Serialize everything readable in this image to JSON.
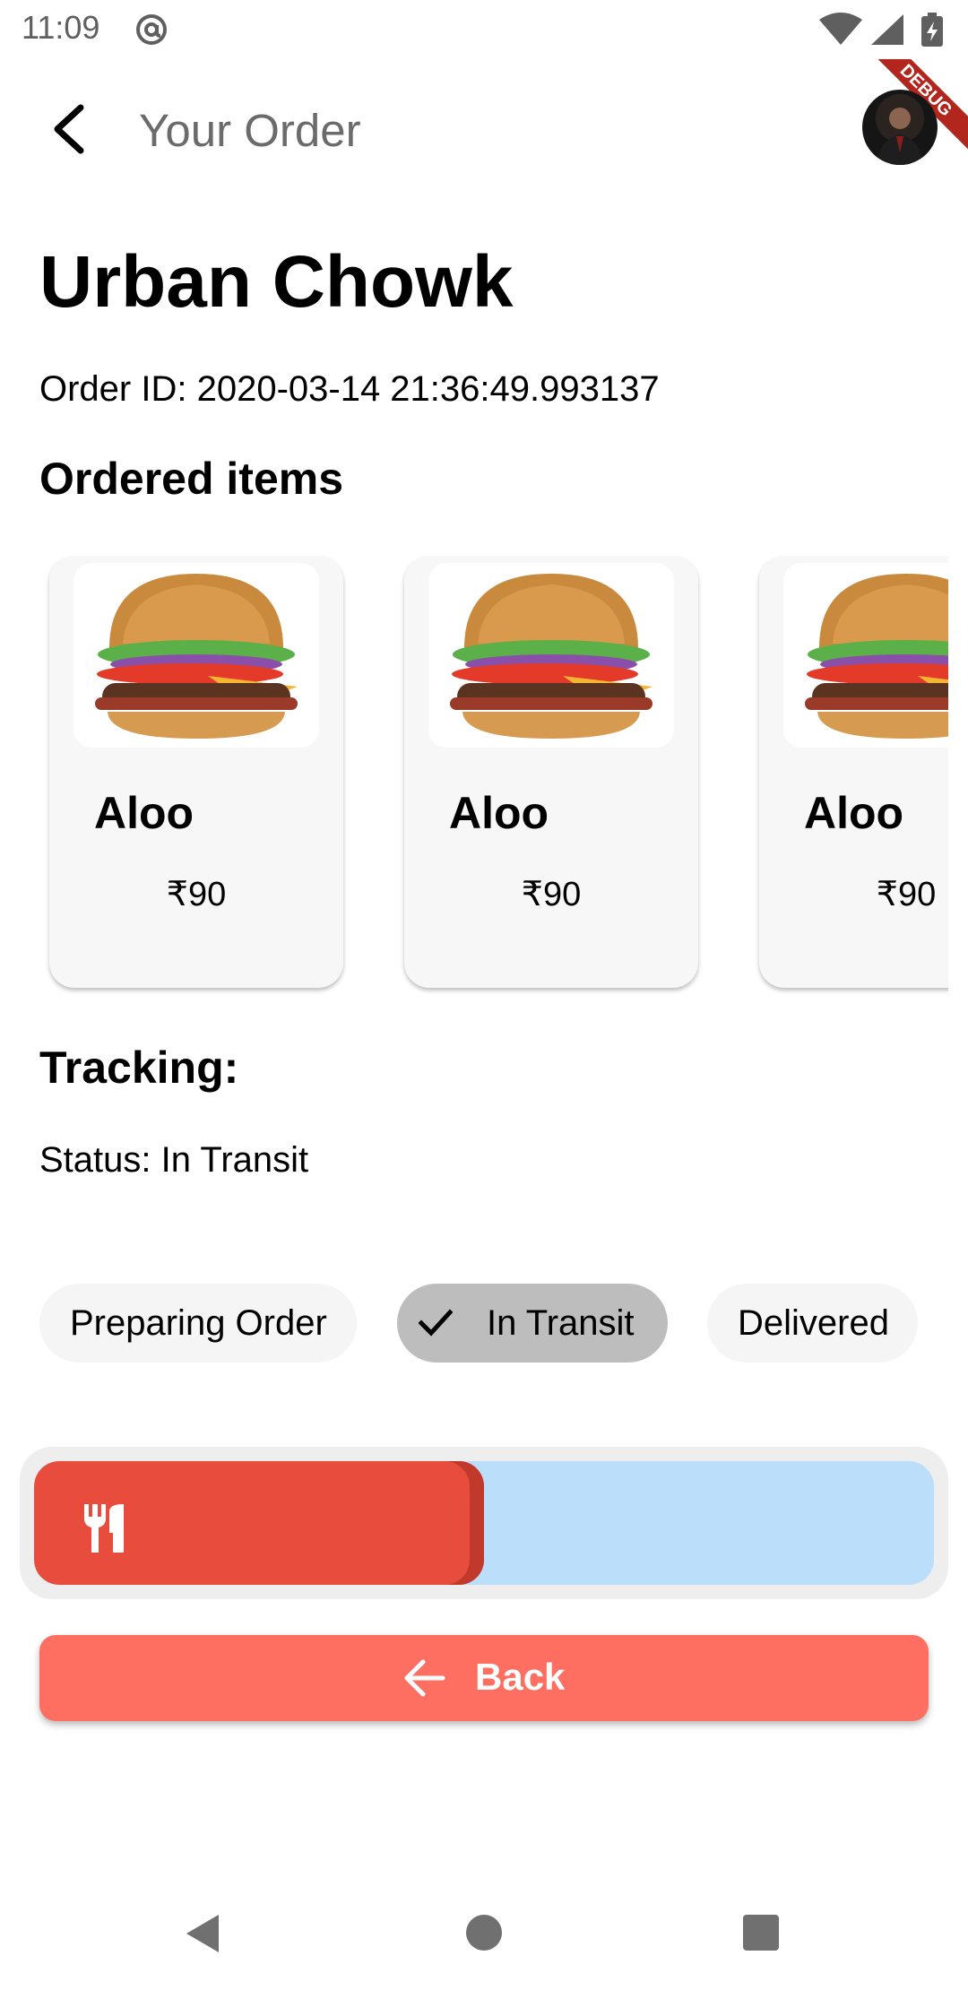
{
  "status_bar": {
    "time": "11:09"
  },
  "debug_banner": {
    "label": "DEBUG"
  },
  "app_bar": {
    "title": "Your Order"
  },
  "restaurant": {
    "name": "Urban Chowk"
  },
  "order": {
    "id_text": "Order ID: 2020-03-14 21:36:49.993137"
  },
  "ordered_items": {
    "heading": "Ordered items",
    "items": [
      {
        "name": "Aloo",
        "price": "₹90"
      },
      {
        "name": "Aloo",
        "price": "₹90"
      },
      {
        "name": "Aloo",
        "price": "₹90"
      }
    ]
  },
  "tracking": {
    "heading": "Tracking:",
    "status_text": "Status: In Transit",
    "chips": [
      {
        "label": "Preparing Order",
        "selected": false
      },
      {
        "label": "In Transit",
        "selected": true
      },
      {
        "label": "Delivered",
        "selected": false
      }
    ],
    "progress_fraction": 0.5,
    "colors": {
      "fill": "#e74c3c",
      "rail": "#bbdefb"
    }
  },
  "back_button": {
    "label": "Back",
    "color": "#ff6f61"
  }
}
